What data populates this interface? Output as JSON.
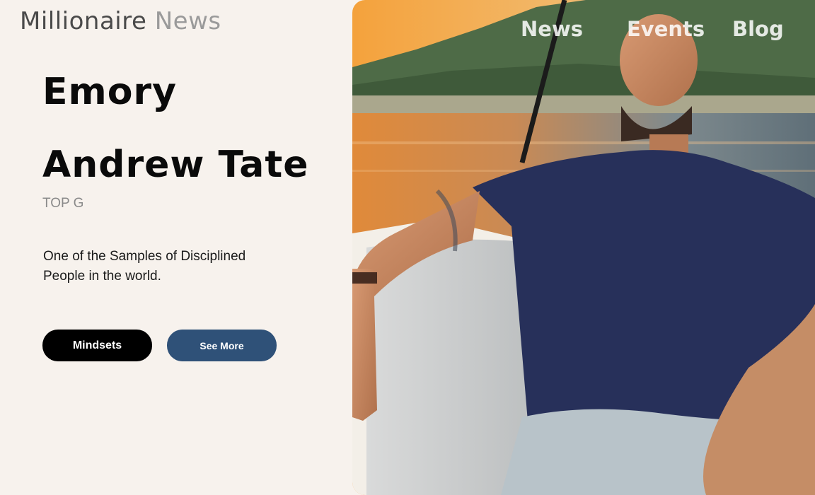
{
  "brand": {
    "word1": "Millionaire",
    "word2": "News"
  },
  "nav": {
    "news": "News",
    "events": "Events",
    "blog": "Blog"
  },
  "hero": {
    "first_name": "Emory",
    "full_name": "Andrew Tate",
    "subtitle": "TOP G",
    "description": "One of the Samples of Disciplined People in the world."
  },
  "buttons": {
    "primary": "Mindsets",
    "secondary": "See More"
  },
  "colors": {
    "background": "#f7f2ed",
    "primary_button": "#000000",
    "secondary_button": "#2f5178"
  }
}
